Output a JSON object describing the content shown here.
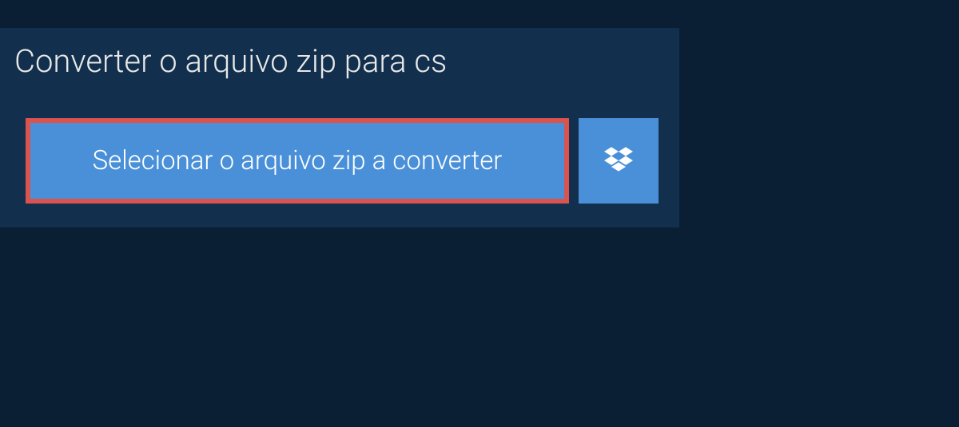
{
  "header": {
    "title": "Converter o arquivo zip para cs"
  },
  "actions": {
    "select_file_label": "Selecionar o arquivo zip a converter"
  }
}
